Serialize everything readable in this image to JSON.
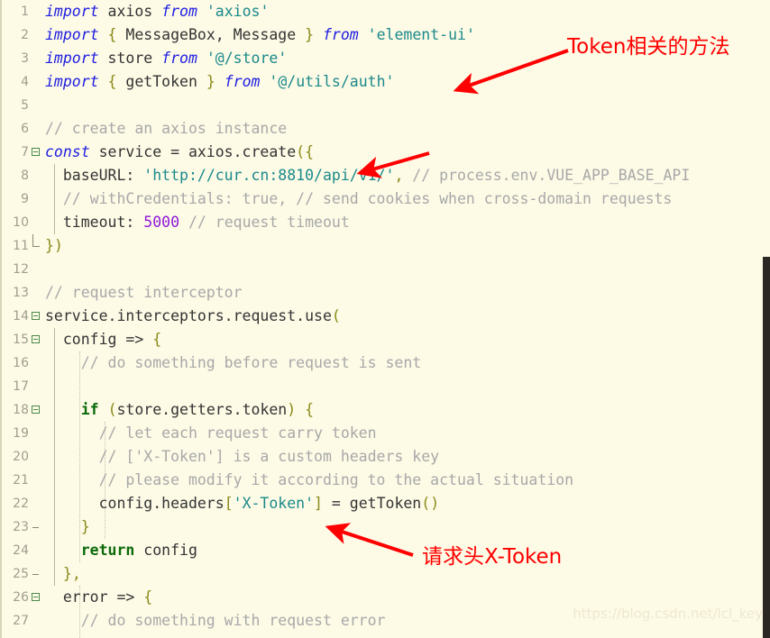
{
  "editor": {
    "background_color": "#fdfae6",
    "gutter_color": "#9f9f8e",
    "scrollbar_color": "#2b2722",
    "lines": [
      {
        "n": "1",
        "fold": "none"
      },
      {
        "n": "2",
        "fold": "none"
      },
      {
        "n": "3",
        "fold": "none"
      },
      {
        "n": "4",
        "fold": "none"
      },
      {
        "n": "5",
        "fold": "none"
      },
      {
        "n": "6",
        "fold": "none"
      },
      {
        "n": "7",
        "fold": "open"
      },
      {
        "n": "8",
        "fold": "none"
      },
      {
        "n": "9",
        "fold": "none"
      },
      {
        "n": "10",
        "fold": "none"
      },
      {
        "n": "11",
        "fold": "end"
      },
      {
        "n": "12",
        "fold": "none"
      },
      {
        "n": "13",
        "fold": "none"
      },
      {
        "n": "14",
        "fold": "open"
      },
      {
        "n": "15",
        "fold": "open"
      },
      {
        "n": "16",
        "fold": "none"
      },
      {
        "n": "17",
        "fold": "none"
      },
      {
        "n": "18",
        "fold": "open"
      },
      {
        "n": "19",
        "fold": "none"
      },
      {
        "n": "20",
        "fold": "none"
      },
      {
        "n": "21",
        "fold": "none"
      },
      {
        "n": "22",
        "fold": "none"
      },
      {
        "n": "23",
        "fold": "end"
      },
      {
        "n": "24",
        "fold": "none"
      },
      {
        "n": "25",
        "fold": "end"
      },
      {
        "n": "26",
        "fold": "open"
      },
      {
        "n": "27",
        "fold": "none"
      }
    ],
    "code_text": [
      "import axios from 'axios'",
      "import { MessageBox, Message } from 'element-ui'",
      "import store from '@/store'",
      "import { getToken } from '@/utils/auth'",
      "",
      "// create an axios instance",
      "const service = axios.create({",
      "  baseURL: 'http://cur.cn:8810/api/v1/', // process.env.VUE_APP_BASE_API",
      "  // withCredentials: true, // send cookies when cross-domain requests",
      "  timeout: 5000 // request timeout",
      "})",
      "",
      "// request interceptor",
      "service.interceptors.request.use(",
      "  config => {",
      "    // do something before request is sent",
      "",
      "    if (store.getters.token) {",
      "      // let each request carry token",
      "      // ['X-Token'] is a custom headers key",
      "      // please modify it according to the actual situation",
      "      config.headers['X-Token'] = getToken()",
      "    }",
      "    return config",
      "  },",
      "  error => {",
      "    // do something with request error"
    ]
  },
  "annotations": [
    {
      "id": "annot-1",
      "text": "Token相关的方法",
      "color": "#ff0000"
    },
    {
      "id": "annot-2",
      "text": "请求头X-Token",
      "color": "#ff0000"
    }
  ],
  "watermark": {
    "text": "https://blog.csdn.net/lcl_key"
  }
}
